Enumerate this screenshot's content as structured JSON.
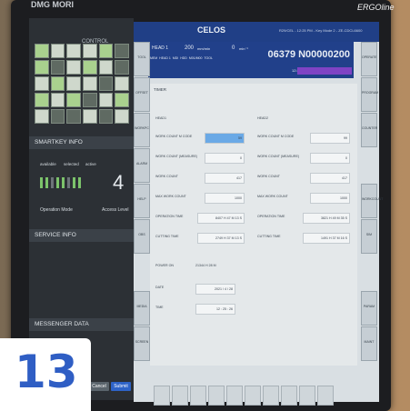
{
  "brand": "DMG MORI",
  "ergo": "ERGOline",
  "left": {
    "control_label": "CONTROL",
    "smartkey_title": "SMARTKEY INFO",
    "smartkey_cols": [
      "available",
      "selected",
      "active"
    ],
    "access_level": "4",
    "operation_mode": "Operation Mode",
    "access_level_label": "Access Level",
    "service_title": "SERVICE INFO",
    "messenger_title": "MESSENGER DATA",
    "cancel_label": "Cancel",
    "submit_label": "Submit"
  },
  "top": {
    "title": "CELOS",
    "info": "R29/CEL - 12:25 PM - Key Mode 2 - ZE-CDCL6600",
    "head": "HEAD 1",
    "speed1": "200",
    "speed1_unit": "mm/min",
    "speed2": "0",
    "speed2_unit": "min⁻¹",
    "program": "06379 N00000200",
    "time": "12:25:25",
    "mode_tabs": [
      "MEM",
      "HEAD 1",
      "MDI",
      "HDD",
      "M01/M00",
      "TOOL"
    ]
  },
  "section_title": "TIMER",
  "columns": [
    {
      "header": "HEAD1",
      "fields": [
        {
          "label": "WORK COUNT M CODE",
          "value": "59",
          "selected": true
        },
        {
          "label": "WORK COUNT (MEASURE)",
          "value": "0"
        },
        {
          "label": "WORK COUNT",
          "value": "417"
        },
        {
          "label": "MAX WORK COUNT",
          "value": "1000"
        },
        {
          "label": "OPERATION TIME",
          "value": "8407 H 47 M 13 S"
        },
        {
          "label": "CUTTING TIME",
          "value": "2749 H 37 M 13 S"
        }
      ]
    },
    {
      "header": "HEAD2",
      "fields": [
        {
          "label": "WORK COUNT M CODE",
          "value": "99"
        },
        {
          "label": "WORK COUNT (MEASURE)",
          "value": "0"
        },
        {
          "label": "WORK COUNT",
          "value": "417"
        },
        {
          "label": "MAX WORK COUNT",
          "value": "1000"
        },
        {
          "label": "OPERATION TIME",
          "value": "3821 H 49 M 35 S"
        },
        {
          "label": "CUTTING TIME",
          "value": "1491 H 37 M 16 S"
        }
      ]
    }
  ],
  "power_on": {
    "label": "POWER ON",
    "value": "21344 H 28 M"
  },
  "date": {
    "label": "DATE",
    "value": "2021 / 4 / 28"
  },
  "time": {
    "label": "TIME",
    "value": "12 : 25 : 26"
  },
  "side_buttons_left": [
    "TOOL",
    "OFFSET",
    "WORKPC",
    "ALARM",
    "HELP",
    "OBS",
    "MEDIA",
    "SCREEN"
  ],
  "side_buttons_right": [
    "OPERATE",
    "PROGRAM",
    "COUNTER",
    "WORKCOUNT",
    "SIM",
    "PARAM",
    "MAINT"
  ],
  "badge": "13"
}
